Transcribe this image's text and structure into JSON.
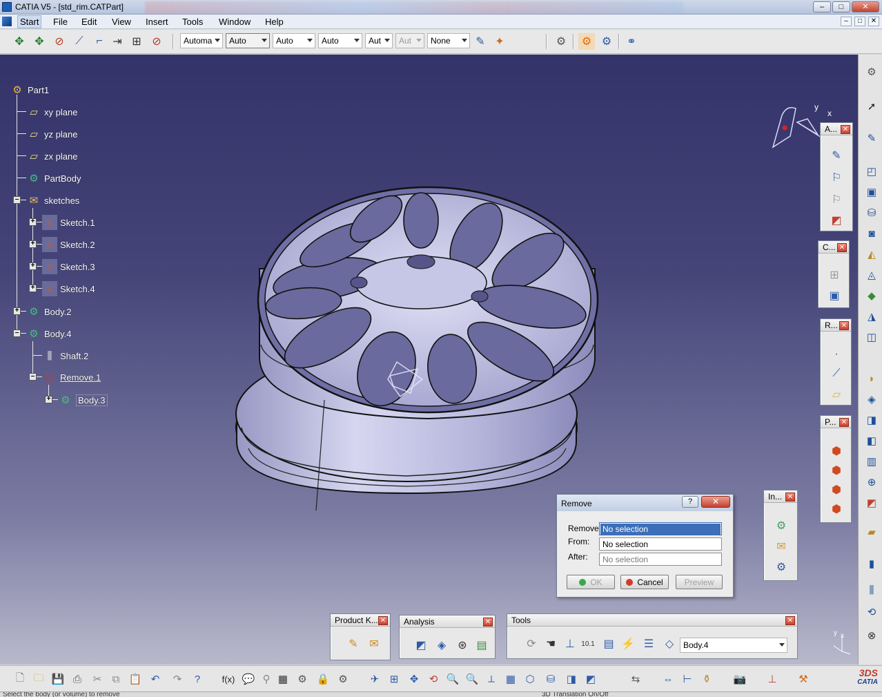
{
  "window": {
    "title": "CATIA V5 - [std_rim.CATPart]",
    "buttons": [
      "–",
      "□",
      "✕"
    ]
  },
  "menu": {
    "items": [
      "Start",
      "File",
      "Edit",
      "View",
      "Insert",
      "Tools",
      "Window",
      "Help"
    ]
  },
  "top_toolbar": {
    "combos": [
      "Automa",
      "Auto",
      "Auto",
      "Auto",
      "Aut",
      "Aut",
      "None"
    ]
  },
  "tree": {
    "nodes": [
      {
        "label": "Part1",
        "icon": "part-icon"
      },
      {
        "label": "xy plane",
        "icon": "plane-icon"
      },
      {
        "label": "yz plane",
        "icon": "plane-icon"
      },
      {
        "label": "zx plane",
        "icon": "plane-icon"
      },
      {
        "label": "PartBody",
        "icon": "body-gear-icon"
      },
      {
        "label": "sketches",
        "icon": "geometrical-set-icon"
      },
      {
        "label": "Sketch.1",
        "icon": "sketch-icon"
      },
      {
        "label": "Sketch.2",
        "icon": "sketch-icon"
      },
      {
        "label": "Sketch.3",
        "icon": "sketch-icon"
      },
      {
        "label": "Sketch.4",
        "icon": "sketch-icon"
      },
      {
        "label": "Body.2",
        "icon": "body-gear-icon"
      },
      {
        "label": "Body.4",
        "icon": "body-gear-icon"
      },
      {
        "label": "Shaft.2",
        "icon": "shaft-icon"
      },
      {
        "label": "Remove.1",
        "icon": "remove-icon"
      },
      {
        "label": "Body.3",
        "icon": "body-gear-icon"
      }
    ]
  },
  "compass": {
    "y_label": "y",
    "x_label": "x"
  },
  "axis_triad": {
    "y_label": "y",
    "x_label": "x",
    "z_label": "z"
  },
  "palettes": {
    "annotations": {
      "title": "A..."
    },
    "constraints": {
      "title": "C..."
    },
    "reference": {
      "title": "R..."
    },
    "part_features": {
      "title": "P..."
    },
    "insert": {
      "title": "In..."
    },
    "product_knowledge": {
      "title": "Product K..."
    },
    "analysis": {
      "title": "Analysis"
    },
    "tools": {
      "title": "Tools",
      "body_select": "Body.4"
    }
  },
  "dialog": {
    "title": "Remove",
    "help": "?",
    "close": "✕",
    "fields": [
      {
        "label": "Remove:",
        "value": "No selection"
      },
      {
        "label": "From:",
        "value": "No selection"
      },
      {
        "label": "After:",
        "value": "No selection"
      }
    ],
    "ok": "OK",
    "cancel": "Cancel",
    "preview": "Preview"
  },
  "status": {
    "left": "Select the body (or volume) to remove",
    "right": "3D Translation On/Off"
  },
  "logo": {
    "text": "CATIA",
    "mark": "3DS"
  },
  "colors": {
    "viewport_top": "#33336a",
    "viewport_bottom": "#b9b9cc",
    "rim": "#b9b9e0",
    "selection": "#3c6fb8"
  }
}
